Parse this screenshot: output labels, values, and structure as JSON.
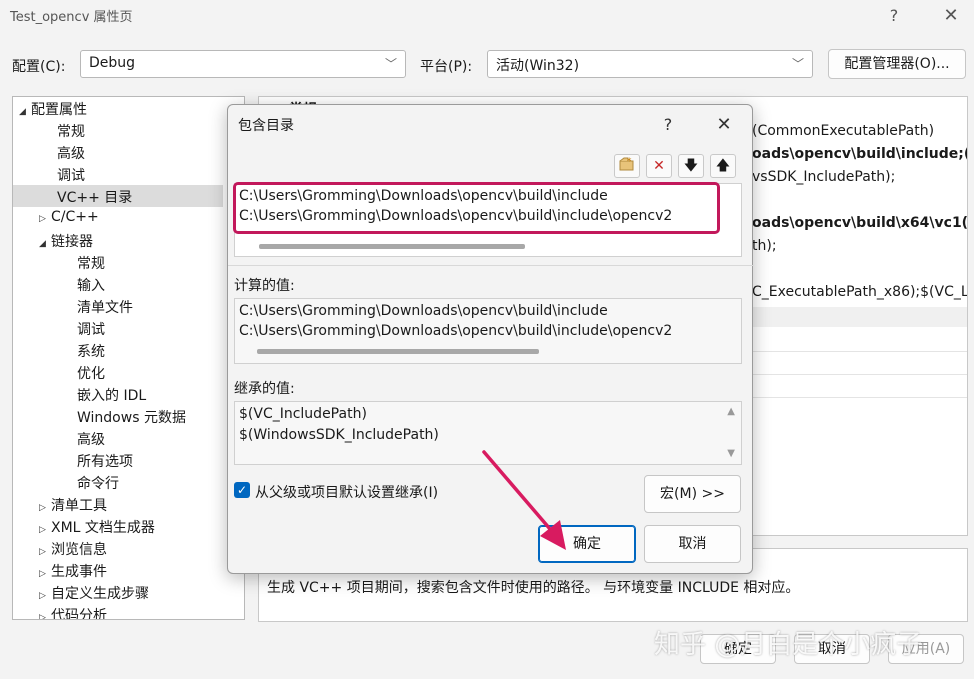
{
  "window": {
    "title": "Test_opencv 属性页",
    "help": "?",
    "close": "✕"
  },
  "toolbar": {
    "config_label": "配置(C):",
    "config_value": "Debug",
    "platform_label": "平台(P):",
    "platform_value": "活动(Win32)",
    "config_manager": "配置管理器(O)..."
  },
  "tree": {
    "items": [
      {
        "label": "配置属性",
        "arrow": "◢"
      },
      {
        "label": "常规"
      },
      {
        "label": "高级"
      },
      {
        "label": "调试"
      },
      {
        "label": "VC++ 目录"
      },
      {
        "label": "C/C++",
        "arrow": "▷"
      },
      {
        "label": "链接器",
        "arrow": "◢"
      },
      {
        "label": "常规"
      },
      {
        "label": "输入"
      },
      {
        "label": "清单文件"
      },
      {
        "label": "调试"
      },
      {
        "label": "系统"
      },
      {
        "label": "优化"
      },
      {
        "label": "嵌入的 IDL"
      },
      {
        "label": "Windows 元数据"
      },
      {
        "label": "高级"
      },
      {
        "label": "所有选项"
      },
      {
        "label": "命令行"
      },
      {
        "label": "清单工具",
        "arrow": "▷"
      },
      {
        "label": "XML 文档生成器",
        "arrow": "▷"
      },
      {
        "label": "浏览信息",
        "arrow": "▷"
      },
      {
        "label": "生成事件",
        "arrow": "▷"
      },
      {
        "label": "自定义生成步骤",
        "arrow": "▷"
      },
      {
        "label": "代码分析",
        "arrow": "▷"
      }
    ]
  },
  "grid": {
    "header": "常规",
    "rows": [
      "(CommonExecutablePath)",
      "oads\\opencv\\build\\include;(",
      "vsSDK_IncludePath);",
      "oads\\opencv\\build\\x64\\vc1(",
      "th);",
      "C_ExecutablePath_x86);$(VC_L"
    ]
  },
  "description": "生成 VC++ 项目期间，搜索包含文件时使用的路径。 与环境变量 INCLUDE 相对应。",
  "bottom_buttons": {
    "ok": "确定",
    "cancel": "取消",
    "apply": "应用(A)"
  },
  "dialog": {
    "title": "包含目录",
    "help": "?",
    "close": "✕",
    "entries": [
      "C:\\Users\\Gromming\\Downloads\\opencv\\build\\include",
      "C:\\Users\\Gromming\\Downloads\\opencv\\build\\include\\opencv2"
    ],
    "computed_label": "计算的值:",
    "computed": [
      "C:\\Users\\Gromming\\Downloads\\opencv\\build\\include",
      "C:\\Users\\Gromming\\Downloads\\opencv\\build\\include\\opencv2"
    ],
    "inherited_label": "继承的值:",
    "inherited": [
      "$(VC_IncludePath)",
      "$(WindowsSDK_IncludePath)"
    ],
    "inherit_checkbox": "从父级或项目默认设置继承(I)",
    "inherit_checked": true,
    "macro_button": "宏(M) >>",
    "ok": "确定",
    "cancel": "取消"
  },
  "watermark": "知乎 @月白是个小疯子",
  "colors": {
    "accent": "#0067c0",
    "highlight": "#c2185b",
    "selected": "#dcdcdc"
  }
}
